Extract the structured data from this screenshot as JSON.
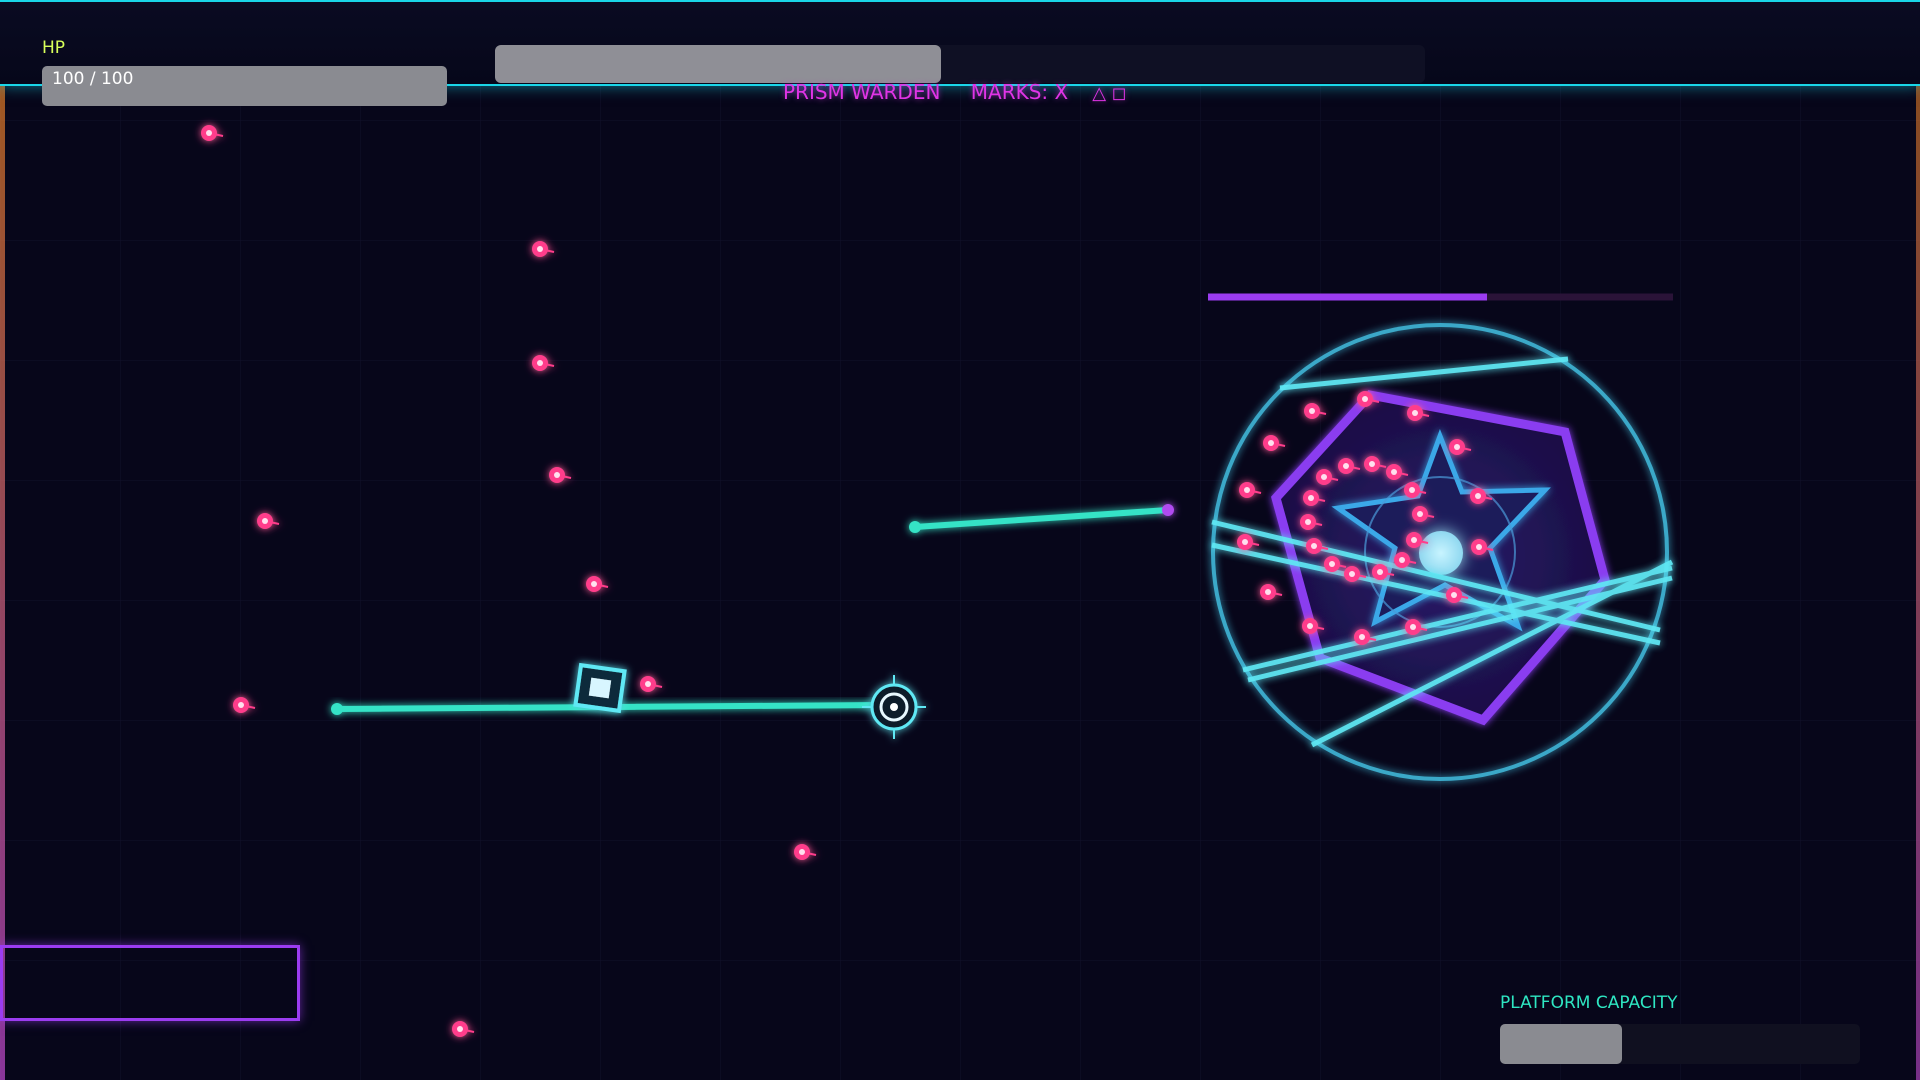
{
  "hud": {
    "hp_label": "HP",
    "hp_text": "100 / 100",
    "hp_fraction": 1.0,
    "boss_name": "PRISM WARDEN",
    "marks_label": "MARKS: X",
    "marks_glyphs": "△ ◻",
    "boss_bar_fraction": 0.48,
    "capacity_label": "PLATFORM CAPACITY",
    "capacity_fraction": 0.34
  },
  "boss": {
    "health_fraction": 0.6,
    "icon": "hexagon-star-core-icon"
  },
  "colors": {
    "cyan": "#1ad6e8",
    "magenta": "#e034e6",
    "purple": "#8a3cf0",
    "pink_bullet": "#ff3d8b",
    "hp_green": "#d8ff5a",
    "teal_text": "#2ee6c2",
    "background": "#07061a"
  }
}
